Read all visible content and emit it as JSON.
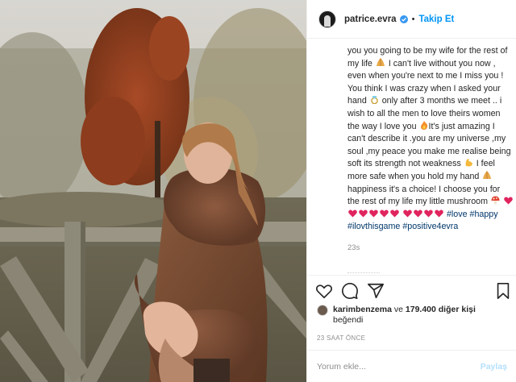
{
  "header": {
    "username": "patrice.evra",
    "separator": "•",
    "follow_label": "Takip Et"
  },
  "caption": {
    "p1": "you you going to be my wife for the rest of my life ",
    "p2": " I can't live without you now , even when you're next to me I miss you ! You think I was crazy when I asked your hand ",
    "p3": " only after 3 months we meet .. i wish to all the men to love theirs women the way I love you ",
    "p4": "It's just amazing I can't describe it .you are my universe ,my soul ,my peace you make me realise being soft its strength not weakness ",
    "p5": " I feel more safe when you hold my hand ",
    "p6": " happiness it's a choice! I choose you for the rest of my life my little mushroom ",
    "hashtags": [
      "#love",
      "#happy",
      "#ilovthisgame",
      "#positive4evra"
    ],
    "age": "23s"
  },
  "likes": {
    "user": "karimbenzema",
    "connector": " ve ",
    "count_text": "179.400 diğer kişi",
    "suffix": "beğendi"
  },
  "timestamp": "23 SAAT ÖNCE",
  "comment": {
    "placeholder": "Yorum ekle...",
    "post_label": "Paylaş"
  },
  "colors": {
    "link_blue": "#0095f6",
    "hashtag": "#00376b",
    "muted": "#8e8e8e",
    "heart_red": "#e0245e"
  },
  "icons": [
    "verified-badge-icon",
    "heart-icon",
    "comment-icon",
    "share-icon",
    "bookmark-icon"
  ]
}
